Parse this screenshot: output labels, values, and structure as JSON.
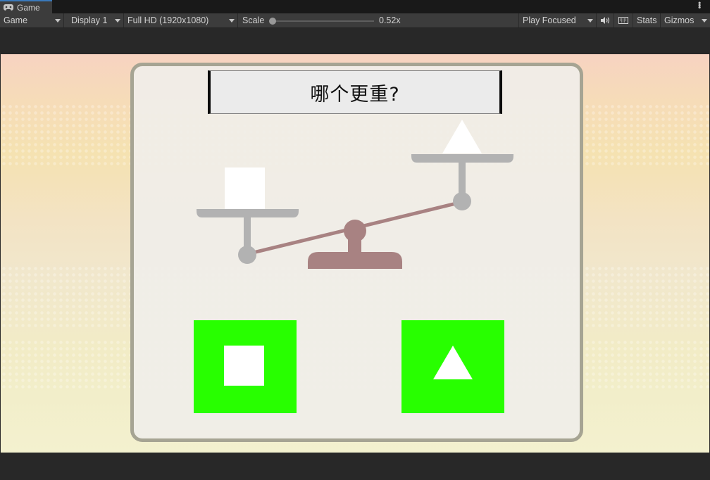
{
  "editor": {
    "tab_title": "Game",
    "toolbar": {
      "view_mode": "Game",
      "display": "Display 1",
      "resolution": "Full HD (1920x1080)",
      "scale_label": "Scale",
      "scale_value": "0.52x",
      "play_mode": "Play Focused",
      "stats": "Stats",
      "gizmos": "Gizmos"
    },
    "colors": {
      "chrome": "#3c3c3c",
      "tab_accent": "#3a79bb"
    }
  },
  "game": {
    "question": "哪个更重?",
    "balance": {
      "left_pan_item": "square",
      "right_pan_item": "triangle",
      "tilt": "left-down"
    },
    "answers": [
      {
        "shape": "square"
      },
      {
        "shape": "triangle"
      }
    ],
    "colors": {
      "answer_button": "#28ff00",
      "beam": "#a88282",
      "pan": "#b2b2b2",
      "panel_border": "#a6a493"
    },
    "icons": [
      "gamepad-icon",
      "speaker-icon",
      "keyboard-icon",
      "kebab-menu-icon"
    ]
  }
}
